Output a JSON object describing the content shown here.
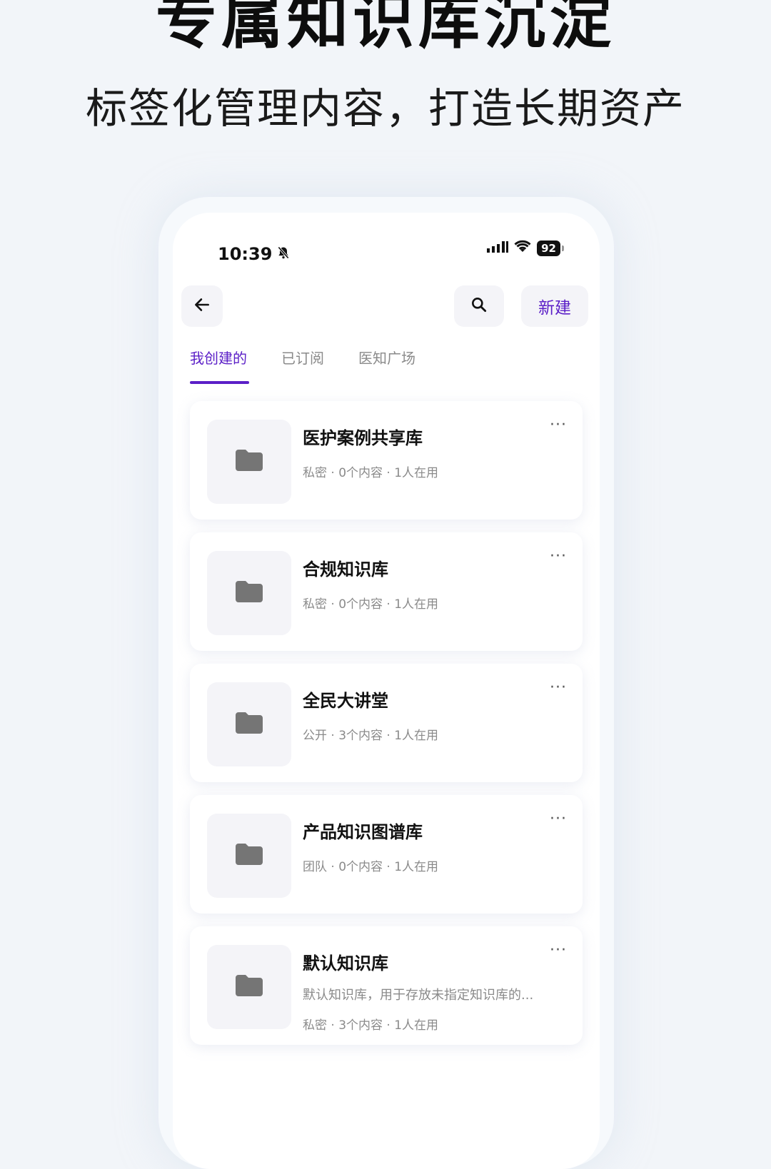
{
  "promo": {
    "headline": "专属知识库沉淀",
    "subline": "标签化管理内容，打造长期资产"
  },
  "status_bar": {
    "time": "10:39",
    "battery": "92"
  },
  "header": {
    "new_label": "新建"
  },
  "tabs": [
    {
      "label": "我创建的",
      "active": true
    },
    {
      "label": "已订阅",
      "active": false
    },
    {
      "label": "医知广场",
      "active": false
    }
  ],
  "libraries": [
    {
      "title": "医护案例共享库",
      "meta": "私密 · 0个内容 · 1人在用"
    },
    {
      "title": "合规知识库",
      "meta": "私密 · 0个内容 · 1人在用"
    },
    {
      "title": "全民大讲堂",
      "meta": "公开 · 3个内容 · 1人在用"
    },
    {
      "title": "产品知识图谱库",
      "meta": "团队 · 0个内容 · 1人在用"
    },
    {
      "title": "默认知识库",
      "description": "默认知识库，用于存放未指定知识库的...",
      "meta": "私密 · 3个内容 · 1人在用"
    }
  ],
  "more_label": "···",
  "colors": {
    "accent": "#5b1fc7",
    "folder": "#757575"
  }
}
